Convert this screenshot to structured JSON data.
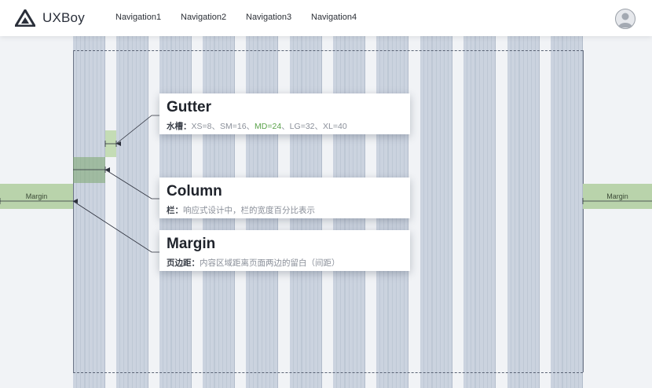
{
  "header": {
    "brand": "UXBoy",
    "nav": [
      "Navigation1",
      "Navigation2",
      "Navigation3",
      "Navigation4"
    ]
  },
  "annotations": {
    "gutter": {
      "title": "Gutter",
      "label": "水槽：",
      "desc_before": "XS=8、SM=16、",
      "desc_highlight": "MD=24",
      "desc_after": "、LG=32、XL=40"
    },
    "column": {
      "title": "Column",
      "label": "栏：",
      "desc": "响应式设计中，栏的宽度百分比表示"
    },
    "margin": {
      "title": "Margin",
      "label": "页边距：",
      "desc": "内容区域距离页面两边的留白（间距）"
    }
  },
  "margin_labels": {
    "left": "Margin",
    "right": "Margin"
  },
  "colors": {
    "column": "#cbd3df",
    "margin_green": "#b9d3ab",
    "highlight": "#5aa24a",
    "background": "#f1f3f6"
  }
}
